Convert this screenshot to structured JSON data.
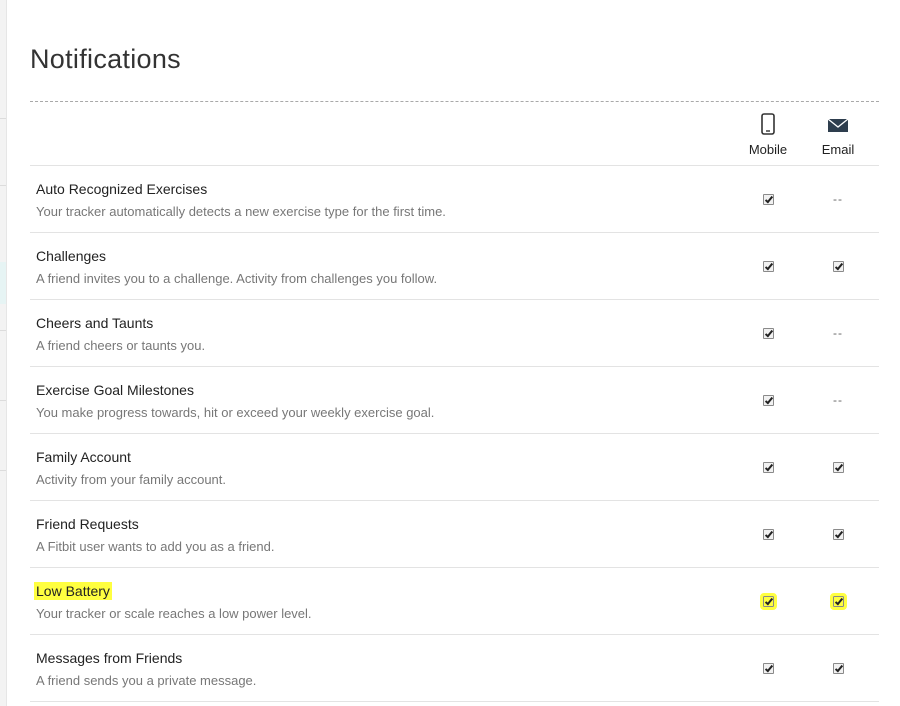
{
  "page": {
    "title": "Notifications"
  },
  "columns": {
    "mobile": "Mobile",
    "email": "Email"
  },
  "icons": {
    "mobile": "mobile-phone-icon",
    "email": "envelope-icon"
  },
  "colors": {
    "highlight": "#ffff40"
  },
  "rows": [
    {
      "title": "Auto Recognized Exercises",
      "description": "Your tracker automatically detects a new exercise type for the first time.",
      "mobile": "checked",
      "email": "--"
    },
    {
      "title": "Challenges",
      "description": "A friend invites you to a challenge. Activity from challenges you follow.",
      "mobile": "checked",
      "email": "checked"
    },
    {
      "title": "Cheers and Taunts",
      "description": "A friend cheers or taunts you.",
      "mobile": "checked",
      "email": "--"
    },
    {
      "title": "Exercise Goal Milestones",
      "description": "You make progress towards, hit or exceed your weekly exercise goal.",
      "mobile": "checked",
      "email": "--"
    },
    {
      "title": "Family Account",
      "description": "Activity from your family account.",
      "mobile": "checked",
      "email": "checked"
    },
    {
      "title": "Friend Requests",
      "description": "A Fitbit user wants to add you as a friend.",
      "mobile": "checked",
      "email": "checked"
    },
    {
      "title": "Low Battery",
      "description": "Your tracker or scale reaches a low power level.",
      "mobile": "checked",
      "email": "checked",
      "highlighted": true
    },
    {
      "title": "Messages from Friends",
      "description": "A friend sends you a private message.",
      "mobile": "checked",
      "email": "checked"
    }
  ]
}
